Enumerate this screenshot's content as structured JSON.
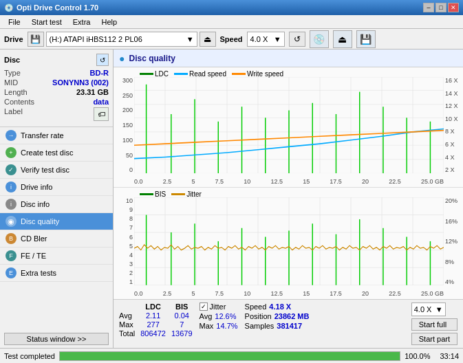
{
  "app": {
    "title": "Opti Drive Control 1.70",
    "icon": "💿"
  },
  "title_controls": {
    "minimize": "–",
    "maximize": "□",
    "close": "✕"
  },
  "menu": {
    "items": [
      "File",
      "Start test",
      "Extra",
      "Help"
    ]
  },
  "toolbar": {
    "drive_label": "Drive",
    "drive_value": "(H:)  ATAPI iHBS112  2 PL06",
    "speed_label": "Speed",
    "speed_value": "4.0 X"
  },
  "disc_panel": {
    "title": "Disc",
    "type_label": "Type",
    "type_value": "BD-R",
    "mid_label": "MID",
    "mid_value": "SONYNN3 (002)",
    "length_label": "Length",
    "length_value": "23.31 GB",
    "contents_label": "Contents",
    "contents_value": "data",
    "label_label": "Label"
  },
  "nav": {
    "items": [
      {
        "id": "transfer-rate",
        "label": "Transfer rate",
        "icon": "→"
      },
      {
        "id": "create-test-disc",
        "label": "Create test disc",
        "icon": "+"
      },
      {
        "id": "verify-test-disc",
        "label": "Verify test disc",
        "icon": "✓"
      },
      {
        "id": "drive-info",
        "label": "Drive info",
        "icon": "i"
      },
      {
        "id": "disc-info",
        "label": "Disc info",
        "icon": "i"
      },
      {
        "id": "disc-quality",
        "label": "Disc quality",
        "icon": "◉",
        "active": true
      },
      {
        "id": "cd-bler",
        "label": "CD Bler",
        "icon": "B"
      },
      {
        "id": "fe-te",
        "label": "FE / TE",
        "icon": "F"
      },
      {
        "id": "extra-tests",
        "label": "Extra tests",
        "icon": "E"
      }
    ],
    "status_window": "Status window >>"
  },
  "chart": {
    "title": "Disc quality",
    "top": {
      "legend": [
        {
          "label": "LDC",
          "color": "#008000"
        },
        {
          "label": "Read speed",
          "color": "#00aaff"
        },
        {
          "label": "Write speed",
          "color": "#ff8800"
        }
      ],
      "y_left": [
        "300",
        "250",
        "200",
        "150",
        "100",
        "50",
        "0"
      ],
      "y_right": [
        "16 X",
        "14 X",
        "12 X",
        "10 X",
        "8 X",
        "6 X",
        "4 X",
        "2 X"
      ],
      "x_labels": [
        "0.0",
        "2.5",
        "5",
        "7.5",
        "10",
        "12.5",
        "15",
        "17.5",
        "20",
        "22.5",
        "25.0 GB"
      ]
    },
    "bottom": {
      "legend": [
        {
          "label": "BIS",
          "color": "#008000"
        },
        {
          "label": "Jitter",
          "color": "#cc8800"
        }
      ],
      "y_left": [
        "10",
        "9",
        "8",
        "7",
        "6",
        "5",
        "4",
        "3",
        "2",
        "1"
      ],
      "y_right": [
        "20%",
        "16%",
        "12%",
        "8%",
        "4%"
      ],
      "x_labels": [
        "0.0",
        "2.5",
        "5",
        "7.5",
        "10",
        "12.5",
        "15",
        "17.5",
        "20",
        "22.5",
        "25.0 GB"
      ]
    }
  },
  "stats": {
    "col_labels": [
      "",
      "LDC",
      "BIS"
    ],
    "rows": [
      {
        "label": "Avg",
        "ldc": "2.11",
        "bis": "0.04"
      },
      {
        "label": "Max",
        "ldc": "277",
        "bis": "7"
      },
      {
        "label": "Total",
        "ldc": "806472",
        "bis": "13679"
      }
    ],
    "jitter": {
      "checked": true,
      "label": "Jitter",
      "rows": [
        {
          "label": "Avg",
          "val": "12.6%"
        },
        {
          "label": "Max",
          "val": "14.7%"
        }
      ]
    },
    "speed": {
      "speed_label": "Speed",
      "speed_val": "4.18 X",
      "position_label": "Position",
      "position_val": "23862 MB",
      "samples_label": "Samples",
      "samples_val": "381417",
      "speed_select": "4.0 X"
    },
    "buttons": {
      "start_full": "Start full",
      "start_part": "Start part"
    }
  },
  "status_bar": {
    "text": "Test completed",
    "progress": 100,
    "progress_label": "100.0%",
    "time": "33:14"
  }
}
